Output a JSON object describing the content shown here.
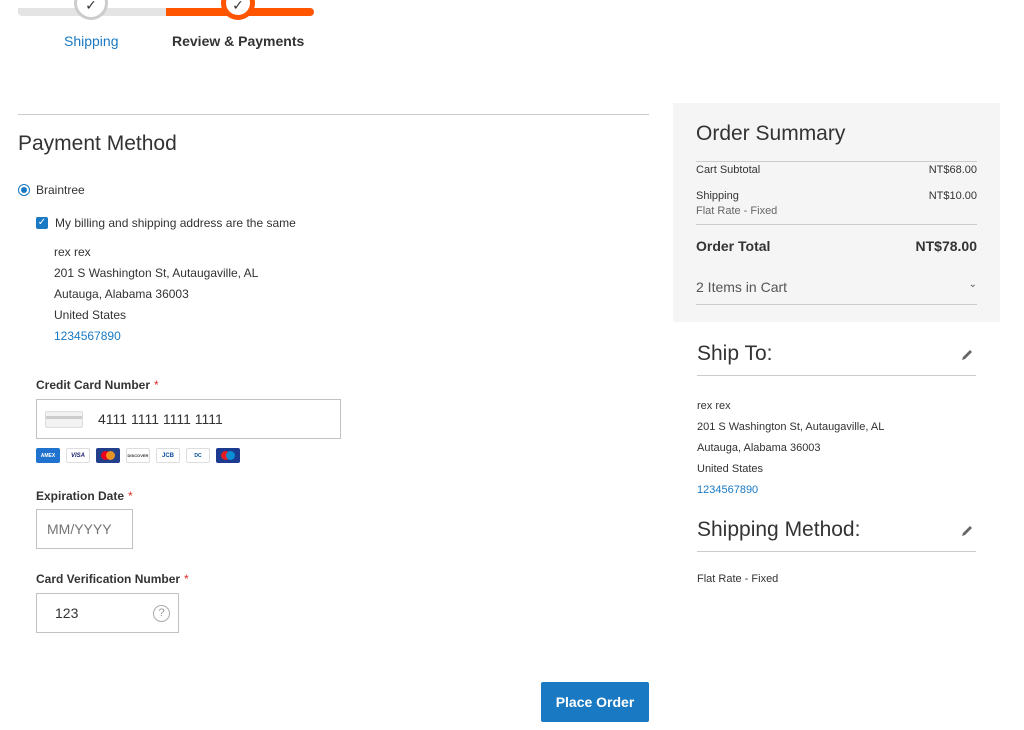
{
  "progress": {
    "steps": [
      {
        "label": "Shipping"
      },
      {
        "label": "Review & Payments"
      }
    ]
  },
  "payment": {
    "title": "Payment Method",
    "method_label": "Braintree",
    "billing_same_label": "My billing and shipping address are the same",
    "address": {
      "name": "rex rex",
      "street": "201 S Washington St, Autaugaville, AL",
      "city_line": "Autauga, Alabama 36003",
      "country": "United States",
      "phone": "1234567890"
    },
    "cc": {
      "label": "Credit Card Number",
      "required_mark": "*",
      "value": "4111 1111 1111 1111",
      "card_types": [
        "amex-icon",
        "visa-icon",
        "mastercard-icon",
        "discover-icon",
        "jcb-icon",
        "diners-icon",
        "maestro-icon"
      ]
    },
    "expiration": {
      "label": "Expiration Date",
      "required_mark": "*",
      "placeholder": "MM/YYYY"
    },
    "cvv": {
      "label": "Card Verification Number",
      "required_mark": "*",
      "value": "123",
      "help_glyph": "?"
    },
    "place_order_label": "Place Order"
  },
  "summary": {
    "title": "Order Summary",
    "subtotal_label": "Cart Subtotal",
    "subtotal_value": "NT$68.00",
    "shipping_label": "Shipping",
    "shipping_sub": "Flat Rate - Fixed",
    "shipping_value": "NT$10.00",
    "total_label": "Order Total",
    "total_value": "NT$78.00",
    "items_label": "2 Items in Cart"
  },
  "ship_to": {
    "title": "Ship To:",
    "name": "rex rex",
    "street": "201 S Washington St, Autaugaville, AL",
    "city_line": "Autauga, Alabama 36003",
    "country": "United States",
    "phone": "1234567890"
  },
  "shipping_method": {
    "title": "Shipping Method:",
    "value": "Flat Rate - Fixed"
  },
  "colors": {
    "accent": "#1979c3",
    "progress_active": "#ff5501",
    "required": "#e02b27"
  }
}
